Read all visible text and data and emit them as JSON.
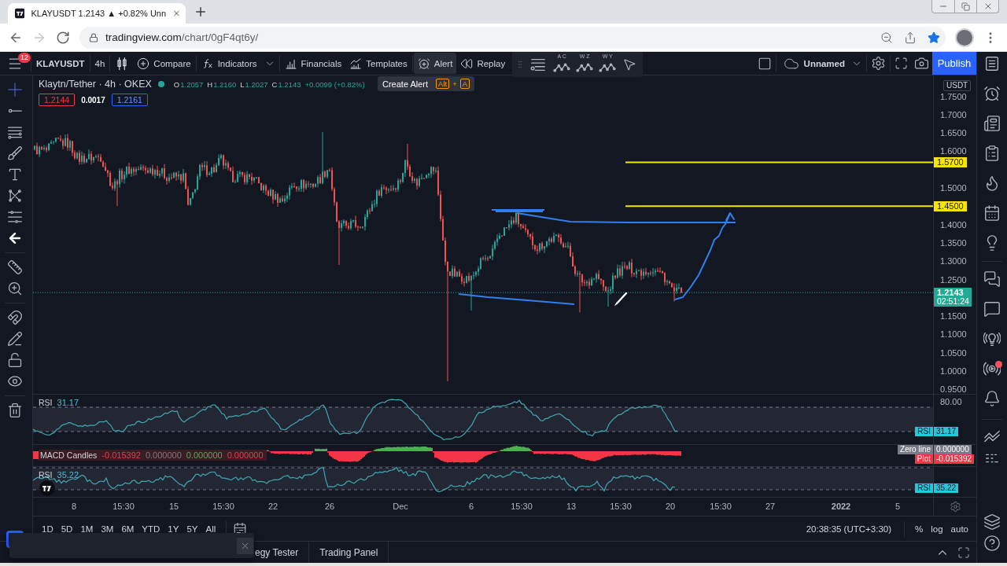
{
  "browser": {
    "tab": {
      "title": "KLAYUSDT 1.2143 ▲ +0.82% Unn"
    },
    "nav": [
      {
        "kind": "back",
        "disabled": false
      },
      {
        "kind": "forward",
        "disabled": true
      },
      {
        "kind": "reload",
        "disabled": false
      }
    ],
    "url": {
      "host": "tradingview.com",
      "path": "/chart/0gF4qt6y/"
    },
    "bookmarked": true
  },
  "header": {
    "menu_badge": "12",
    "symbol": "KLAYUSDT",
    "interval": "4h",
    "buttons": [
      {
        "kind": "compare",
        "label": "Compare",
        "highlighted": false
      },
      {
        "kind": "indicators",
        "label": "Indicators",
        "highlighted": false
      },
      {
        "kind": "financials",
        "label": "Financials",
        "highlighted": false
      },
      {
        "kind": "templates",
        "label": "Templates",
        "highlighted": false
      },
      {
        "kind": "alert",
        "label": "Alert",
        "highlighted": true
      },
      {
        "kind": "replay",
        "label": "Replay",
        "highlighted": false
      }
    ],
    "pattern_tools": [
      {
        "letters": "A C"
      },
      {
        "letters": "W Z"
      },
      {
        "letters": "W Y"
      }
    ],
    "layout_name": "Unnamed",
    "publish": "Publish"
  },
  "tooltip": {
    "text": "Create Alert",
    "keys": [
      "Alt",
      "A"
    ],
    "joiner": "+"
  },
  "drawing_tools": [
    {
      "kind": "crosshair",
      "selected": true
    },
    {
      "kind": "trend_line",
      "selected": false
    },
    {
      "kind": "parallel_lines",
      "selected": false
    },
    {
      "kind": "brush",
      "selected": false
    },
    {
      "kind": "text",
      "selected": false
    },
    {
      "kind": "pattern",
      "selected": false
    },
    {
      "kind": "projection",
      "selected": false
    },
    {
      "kind": "collapse",
      "selected": false
    },
    {
      "kind": "ruler",
      "selected": false
    },
    {
      "kind": "zoom",
      "selected": false
    },
    {
      "kind": "magnet",
      "selected": false
    },
    {
      "kind": "lock_drawings",
      "selected": false
    },
    {
      "kind": "lock",
      "selected": false
    },
    {
      "kind": "hide",
      "selected": false
    },
    {
      "kind": "remove",
      "selected": false
    }
  ],
  "legend": {
    "title": "Klaytn/Tether · 4h · OKEX",
    "market_open": true,
    "change_positive": true,
    "ohlc": [
      {
        "label": "O",
        "value": "1.2057"
      },
      {
        "label": "H",
        "value": "1.2160"
      },
      {
        "label": "L",
        "value": "1.2027"
      },
      {
        "label": "C",
        "value": "1.2143"
      }
    ],
    "change": "+0.0099 (+0.82%)",
    "bid": "1.2144",
    "spread": "0.0017",
    "ask": "1.2161"
  },
  "price_axis": {
    "currency": "USDT",
    "ticks": [
      "1.7500",
      "1.7000",
      "1.6500",
      "1.6000",
      "1.5000",
      "1.4000",
      "1.3500",
      "1.3000",
      "1.2500",
      "1.1500",
      "1.1000",
      "1.0500",
      "1.0000",
      "0.9500"
    ],
    "horizontal_rays": [
      {
        "price": "1.5700"
      },
      {
        "price": "1.4500"
      }
    ],
    "last": {
      "price": "1.2143",
      "countdown": "02:51:24"
    }
  },
  "panes": [
    {
      "kind": "rsi",
      "title": "RSI",
      "value": "31.17",
      "axis_ticks": [
        "80.00"
      ],
      "tags": [
        {
          "label": "RSI",
          "value": "31.17",
          "color": "#26c6da"
        }
      ]
    },
    {
      "kind": "macd",
      "title": "MACD Candles",
      "values": [
        {
          "text": "-0.015392",
          "kind": "plot"
        },
        {
          "text": "0.000000",
          "kind": "zero_line"
        },
        {
          "text": "0.000000",
          "kind": "up"
        },
        {
          "text": "0.000000",
          "kind": "down"
        }
      ],
      "tags": [
        {
          "label": "Zero line",
          "value": "0.000000",
          "color": "#787b86"
        },
        {
          "label": "Plot",
          "value": "-0.015392",
          "color": "#f23645"
        }
      ]
    },
    {
      "kind": "rsi",
      "title": "RSI",
      "value": "35.22",
      "tags": [
        {
          "label": "RSI",
          "value": "35.22",
          "color": "#26c6da"
        }
      ]
    }
  ],
  "time_axis": [
    {
      "label": "8",
      "bold": false
    },
    {
      "label": "15:30",
      "bold": false
    },
    {
      "label": "15",
      "bold": false
    },
    {
      "label": "15:30",
      "bold": false
    },
    {
      "label": "22",
      "bold": false
    },
    {
      "label": "26",
      "bold": false
    },
    {
      "label": "Dec",
      "bold": false
    },
    {
      "label": "6",
      "bold": false
    },
    {
      "label": "15:30",
      "bold": false
    },
    {
      "label": "13",
      "bold": false
    },
    {
      "label": "15:30",
      "bold": false
    },
    {
      "label": "20",
      "bold": false
    },
    {
      "label": "15:30",
      "bold": false
    },
    {
      "label": "27",
      "bold": false
    },
    {
      "label": "2022",
      "bold": true
    },
    {
      "label": "5",
      "bold": false
    }
  ],
  "bottom_bar": {
    "ranges": [
      "1D",
      "5D",
      "1M",
      "3M",
      "6M",
      "YTD",
      "1Y",
      "5Y",
      "All"
    ],
    "clock": "20:38:35 (UTC+3:30)",
    "scale_options": [
      "%",
      "log",
      "auto"
    ]
  },
  "panel_tabs": [
    "egy Tester",
    "Trading Panel"
  ],
  "sidebar": {
    "groups": [
      {
        "items": [
          {
            "kind": "watchlist",
            "unread": false
          },
          {
            "kind": "alerts",
            "unread": false
          },
          {
            "kind": "news",
            "unread": false
          },
          {
            "kind": "details",
            "unread": false
          },
          {
            "kind": "hotlist",
            "unread": false
          },
          {
            "kind": "calendar",
            "unread": false
          },
          {
            "kind": "ideas",
            "unread": false
          }
        ]
      },
      {
        "items": [
          {
            "kind": "chats",
            "unread": false
          },
          {
            "kind": "chat",
            "unread": false
          },
          {
            "kind": "streams",
            "unread": false
          },
          {
            "kind": "broadcast",
            "unread": true
          },
          {
            "kind": "notifications",
            "unread": false
          }
        ]
      },
      {
        "items": [
          {
            "kind": "signals",
            "unread": false
          },
          {
            "kind": "depth",
            "unread": false
          }
        ]
      },
      {
        "items": [
          {
            "kind": "layers",
            "unread": false
          },
          {
            "kind": "help",
            "unread": false
          }
        ]
      }
    ]
  }
}
